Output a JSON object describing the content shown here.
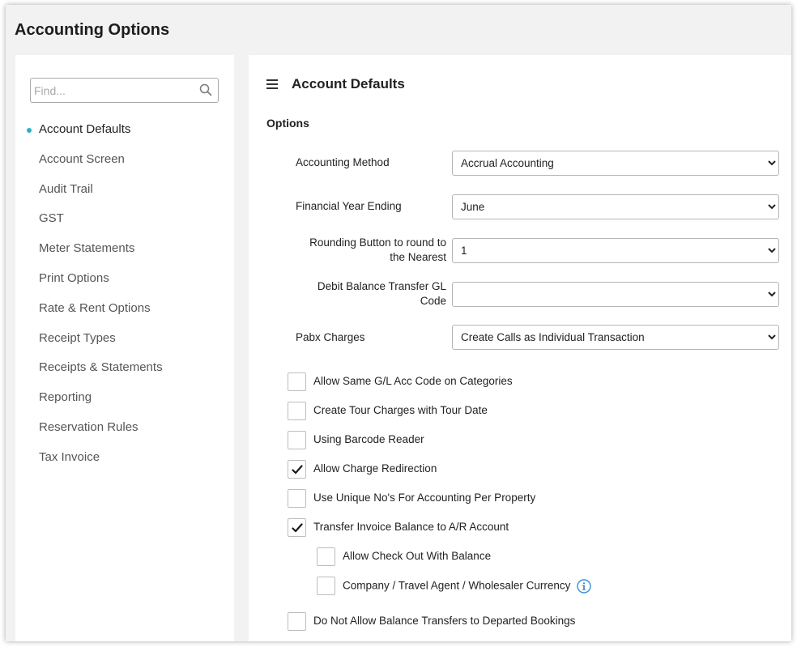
{
  "page": {
    "title": "Accounting Options"
  },
  "sidebar": {
    "search_placeholder": "Find...",
    "items": [
      {
        "label": "Account Defaults",
        "active": true
      },
      {
        "label": "Account Screen"
      },
      {
        "label": "Audit Trail"
      },
      {
        "label": "GST"
      },
      {
        "label": "Meter Statements"
      },
      {
        "label": "Print Options"
      },
      {
        "label": "Rate & Rent Options"
      },
      {
        "label": "Receipt Types"
      },
      {
        "label": "Receipts & Statements"
      },
      {
        "label": "Reporting"
      },
      {
        "label": "Reservation Rules"
      },
      {
        "label": "Tax Invoice"
      }
    ]
  },
  "main": {
    "section_title": "Account Defaults",
    "options_label": "Options",
    "fields": [
      {
        "label": "Accounting Method",
        "value": "Accrual Accounting"
      },
      {
        "label": "Financial Year Ending",
        "value": "June"
      },
      {
        "label_line1": "Rounding Button to round to",
        "label_line2": "the Nearest",
        "value": "1"
      },
      {
        "label_line1": "Debit Balance Transfer GL",
        "label_line2": "Code",
        "value": ""
      },
      {
        "label": "Pabx Charges",
        "value": "Create Calls as Individual Transaction"
      }
    ],
    "checkboxes": [
      {
        "label": "Allow Same G/L Acc Code on Categories",
        "checked": false
      },
      {
        "label": "Create Tour Charges with Tour Date",
        "checked": false
      },
      {
        "label": "Using Barcode Reader",
        "checked": false
      },
      {
        "label": "Allow Charge Redirection",
        "checked": true
      },
      {
        "label": "Use Unique No's For Accounting Per Property",
        "checked": false
      },
      {
        "label": "Transfer Invoice Balance to A/R Account",
        "checked": true
      },
      {
        "label": "Allow Check Out With Balance",
        "checked": false
      },
      {
        "label": "Company / Travel Agent / Wholesaler Currency",
        "checked": false
      },
      {
        "label": "Do Not Allow Balance Transfers to Departed Bookings",
        "checked": false
      }
    ]
  },
  "colors": {
    "accent_dot": "#2bb3c0",
    "info_icon": "#3a8fd8"
  }
}
